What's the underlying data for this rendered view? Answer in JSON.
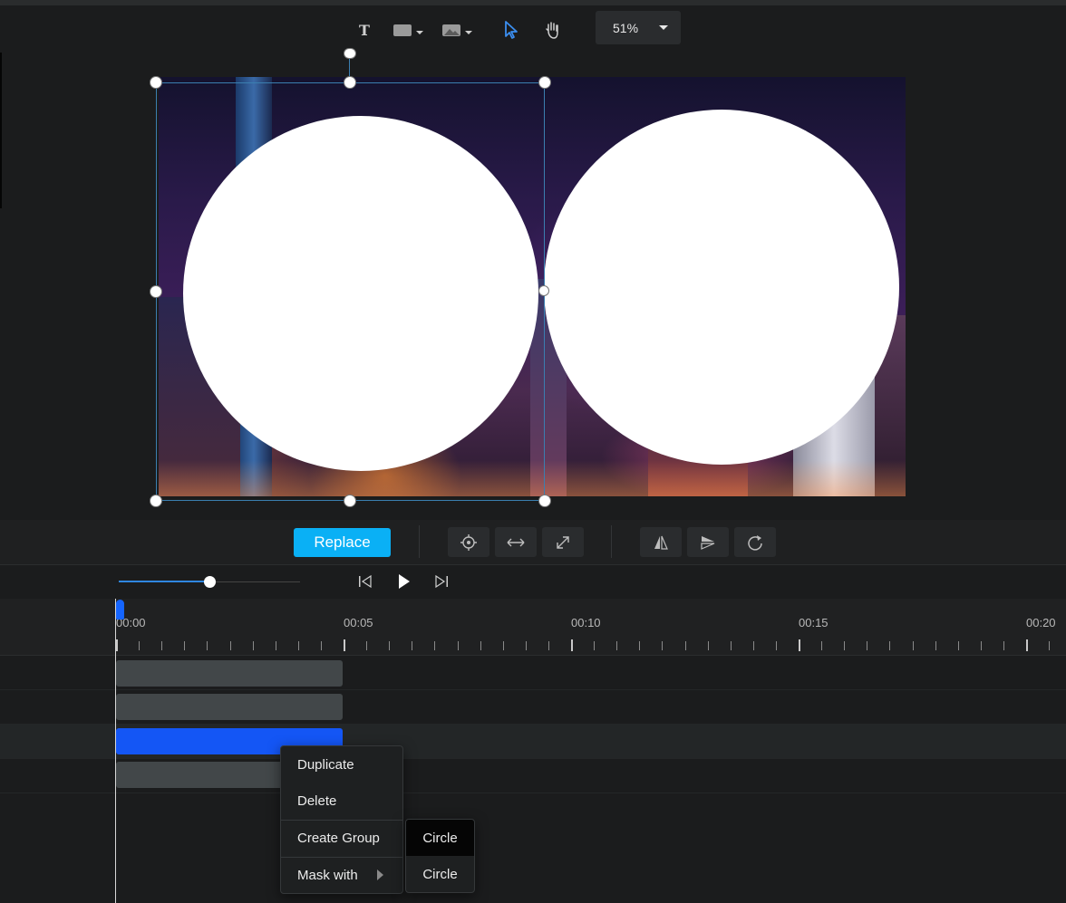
{
  "toolbar": {
    "tools": [
      {
        "name": "text-tool",
        "icon": "text-T-icon"
      },
      {
        "name": "shape-tool",
        "icon": "rectangle-icon"
      },
      {
        "name": "image-tool",
        "icon": "image-icon"
      },
      {
        "name": "select-tool",
        "icon": "pointer-arrow-icon",
        "active": true
      },
      {
        "name": "pan-tool",
        "icon": "hand-icon"
      }
    ],
    "zoom_label": "51%"
  },
  "canvas": {
    "accent_color": "#3b7fb0"
  },
  "actions": {
    "replace_label": "Replace",
    "icons": [
      "target-icon",
      "horizontal-resize-icon",
      "expand-diagonal-icon",
      "flip-horizontal-icon",
      "flip-vertical-icon",
      "rotate-icon"
    ]
  },
  "playback": {
    "volume": 0.5,
    "icons": [
      "skip-back-icon",
      "play-icon",
      "skip-forward-icon"
    ]
  },
  "timeline": {
    "labels": [
      "00:00",
      "00:05",
      "00:10",
      "00:15",
      "00:20"
    ],
    "tracks": [
      {
        "selected": false
      },
      {
        "selected": false
      },
      {
        "selected": true
      },
      {
        "selected": false
      }
    ],
    "selected_color": "#1456f5"
  },
  "context_menu": {
    "items": [
      "Duplicate",
      "Delete",
      "Create Group",
      "Mask with"
    ],
    "submenu": [
      "Circle",
      "Circle"
    ]
  }
}
